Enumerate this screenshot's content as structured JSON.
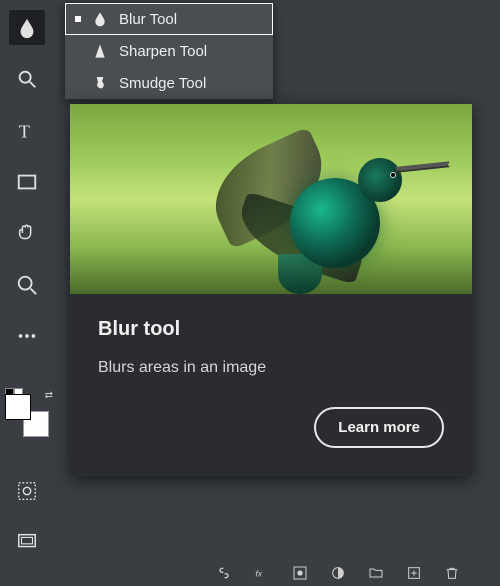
{
  "toolbar": {
    "active_tool": "blur",
    "tools": [
      "blur",
      "zoom",
      "type",
      "rectangle",
      "hand",
      "magnify",
      "more"
    ],
    "swatch_front": "#ffffff",
    "swatch_back": "#ffffff",
    "extra": [
      "quickmask",
      "screenmode"
    ]
  },
  "flyout": {
    "items": [
      {
        "label": "Blur Tool",
        "icon": "blur-icon",
        "selected": true
      },
      {
        "label": "Sharpen Tool",
        "icon": "sharpen-icon",
        "selected": false
      },
      {
        "label": "Smudge Tool",
        "icon": "smudge-icon",
        "selected": false
      }
    ]
  },
  "tip": {
    "title": "Blur tool",
    "desc": "Blurs areas in an image",
    "cta": "Learn more"
  },
  "bottombar": [
    "link",
    "fx",
    "mask",
    "adjust",
    "folder",
    "new",
    "delete"
  ]
}
